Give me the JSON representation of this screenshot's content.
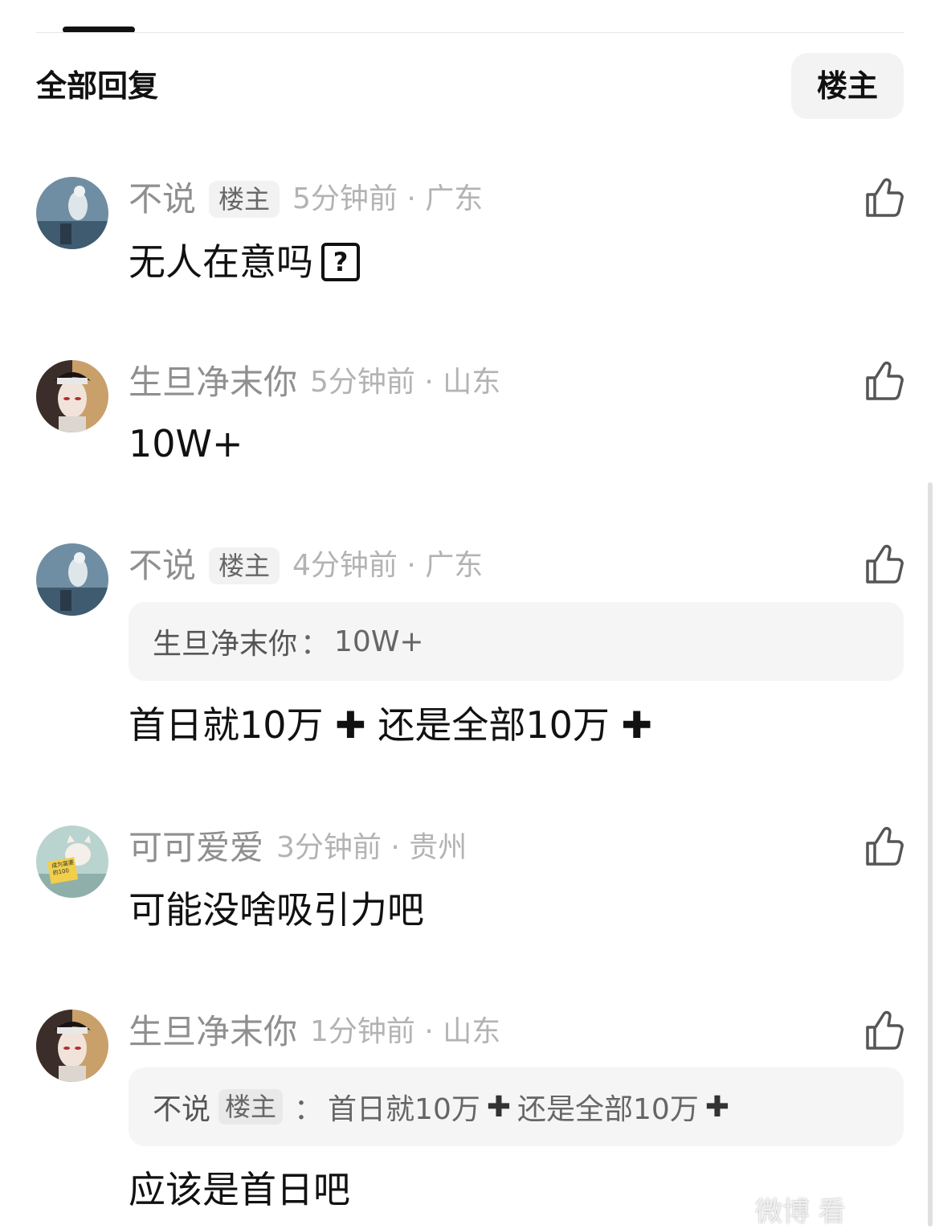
{
  "header": {
    "title": "全部回复",
    "filter_button_label": "楼主"
  },
  "colors": {
    "meta_gray": "#8f8f8f",
    "time_gray": "#b3b3b3",
    "badge_bg": "#f2f2f2",
    "quote_bg": "#f5f5f5",
    "text": "#111111"
  },
  "comments": [
    {
      "username": "不说",
      "badge": "楼主",
      "time": "5分钟前 · 广东",
      "text": "无人在意吗",
      "emoji": "?",
      "avatar": "avatar-statue-icon"
    },
    {
      "username": "生旦净末你",
      "time": "5分钟前 · 山东",
      "text": "10W+",
      "avatar": "avatar-opera-icon"
    },
    {
      "username": "不说",
      "badge": "楼主",
      "time": "4分钟前 · 广东",
      "quote": {
        "user": "生旦净末你",
        "sep": "：",
        "text": "10W+"
      },
      "text_part1": "首日就10万",
      "plus": "✚",
      "text_part2": "还是全部10万",
      "avatar": "avatar-statue-icon"
    },
    {
      "username": "可可爱爱",
      "time": "3分钟前 · 贵州",
      "text": "可能没啥吸引力吧",
      "avatar": "avatar-cat-icon",
      "avatar_book_text": "成为富婆的100"
    },
    {
      "username": "生旦净末你",
      "time": "1分钟前 · 山东",
      "quote": {
        "user": "不说",
        "badge": "楼主",
        "sep": "：",
        "text_part1": "首日就10万",
        "text_part2": "还是全部10万"
      },
      "text": "应该是首日吧",
      "avatar": "avatar-opera-icon"
    }
  ],
  "like_icon": "thumbs-up-icon",
  "watermark": "微博 看"
}
